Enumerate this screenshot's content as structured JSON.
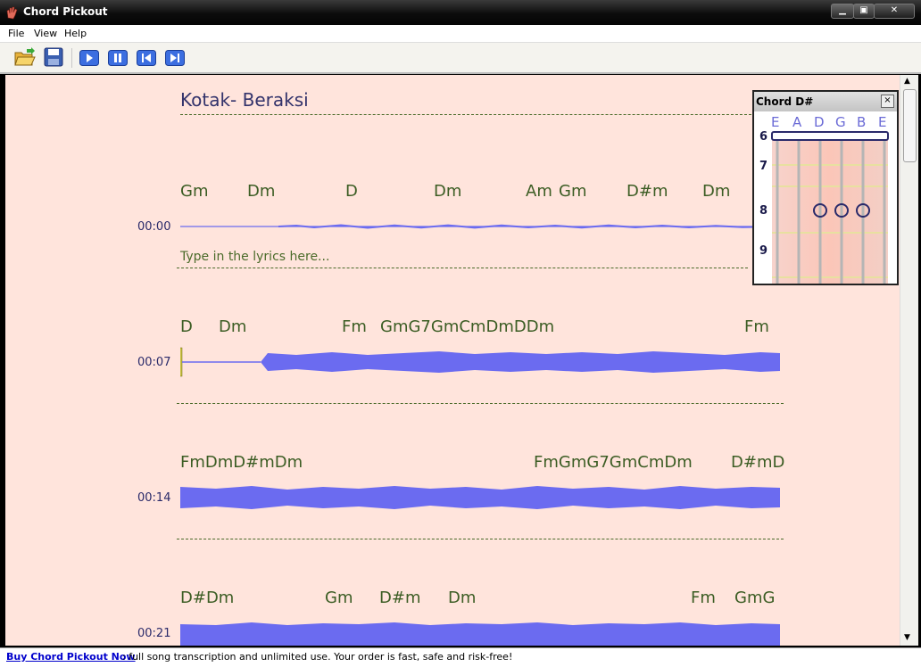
{
  "window": {
    "title": "Chord Pickout"
  },
  "menu": [
    "File",
    "View",
    "Help"
  ],
  "toolbar": {
    "buttons": [
      "open-icon",
      "save-icon",
      "play-icon",
      "pause-icon",
      "skip-back-icon",
      "skip-forward-icon"
    ]
  },
  "song": {
    "title": "Kotak- Beraksi",
    "lyrics_placeholder": "Type in the lyrics here...",
    "lines": [
      {
        "time": "00:00",
        "chords": [
          "Gm",
          "Dm",
          "D",
          "Dm",
          "Am",
          "Gm",
          "D#m",
          "Dm"
        ]
      },
      {
        "time": "00:07",
        "chords": [
          "D",
          "Dm",
          "Fm",
          "GmG7GmCmDmDDm",
          "Fm"
        ]
      },
      {
        "time": "00:14",
        "chords": [
          "FmDmD#mDm",
          "FmGmG7GmCmDm",
          "D#mD"
        ]
      },
      {
        "time": "00:21",
        "chords": [
          "D#Dm",
          "Gm",
          "D#m",
          "Dm",
          "Fm",
          "GmG"
        ]
      }
    ]
  },
  "chord_panel": {
    "title": "Chord D#",
    "close": "×",
    "strings": [
      "E",
      "A",
      "D",
      "G",
      "B",
      "E"
    ],
    "frets": [
      "6",
      "7",
      "8",
      "9"
    ]
  },
  "status": {
    "buy_link": "Buy Chord Pickout Now",
    "message": ": full song transcription and unlimited use. Your order is fast, safe and risk-free!"
  },
  "colors": {
    "background": "#ffe4dc",
    "waveform": "#6b6bf0",
    "chord_text": "#3c5d24"
  }
}
